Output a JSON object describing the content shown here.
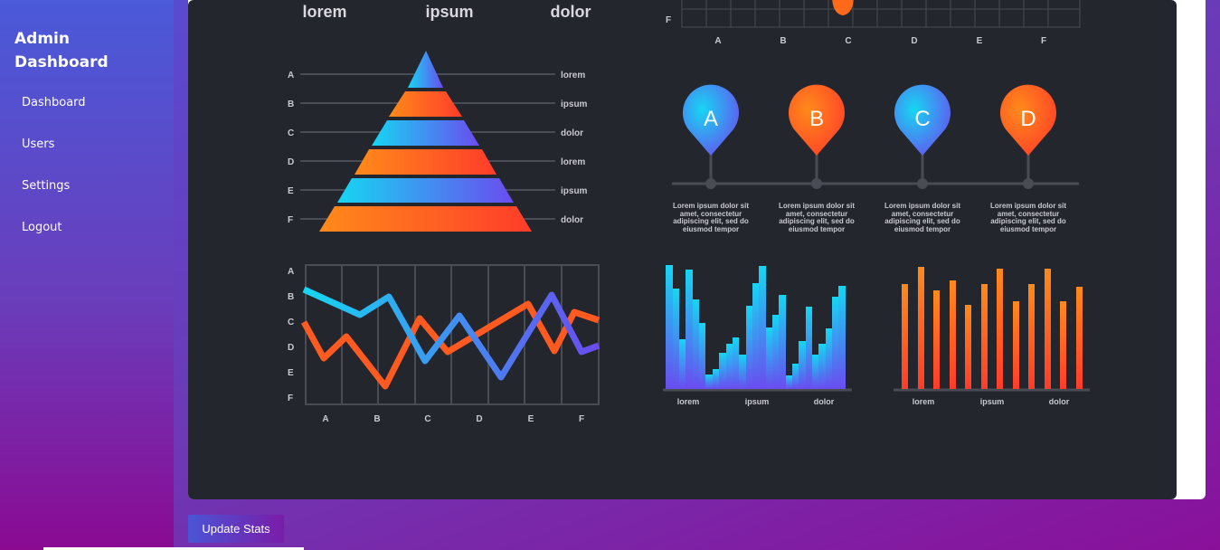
{
  "sidebar": {
    "title": "Admin Dashboard",
    "items": [
      {
        "label": "Dashboard"
      },
      {
        "label": "Users"
      },
      {
        "label": "Settings"
      },
      {
        "label": "Logout"
      }
    ]
  },
  "actions": {
    "update_label": "Update Stats"
  },
  "infographic": {
    "top_labels": [
      "lorem",
      "ipsum",
      "dolor"
    ],
    "grid_top": {
      "y_label": "F",
      "x_labels": [
        "A",
        "B",
        "C",
        "D",
        "E",
        "F"
      ]
    },
    "pyramid": {
      "left_labels": [
        "A",
        "B",
        "C",
        "D",
        "E",
        "F"
      ],
      "right_labels": [
        "lorem",
        "ipsum",
        "dolor",
        "lorem",
        "ipsum",
        "dolor"
      ]
    },
    "pins": [
      {
        "letter": "A",
        "text": [
          "Lorem ipsum dolor sit",
          "amet, consectetur",
          "adipiscing elit, sed do",
          "eiusmod tempor"
        ]
      },
      {
        "letter": "B",
        "text": [
          "Lorem ipsum dolor sit",
          "amet, consectetur",
          "adipiscing elit, sed do",
          "eiusmod tempor"
        ]
      },
      {
        "letter": "C",
        "text": [
          "Lorem ipsum dolor sit",
          "amet, consectetur",
          "adipiscing elit, sed do",
          "eiusmod tempor"
        ]
      },
      {
        "letter": "D",
        "text": [
          "Lorem ipsum dolor sit",
          "amet, consectetur",
          "adipiscing elit, sed do",
          "eiusmod tempor"
        ]
      }
    ],
    "line_chart": {
      "y_labels": [
        "A",
        "B",
        "C",
        "D",
        "E",
        "F"
      ],
      "x_labels": [
        "A",
        "B",
        "C",
        "D",
        "E",
        "F"
      ]
    },
    "bar_chart_blue": {
      "x_labels": [
        "lorem",
        "ipsum",
        "dolor"
      ]
    },
    "bar_chart_orange": {
      "x_labels": [
        "lorem",
        "ipsum",
        "dolor"
      ]
    },
    "colors": {
      "cyan": "#16d6f2",
      "purple": "#6a4cf0",
      "orange": "#ff7a1a",
      "red": "#ff3c2a"
    }
  }
}
